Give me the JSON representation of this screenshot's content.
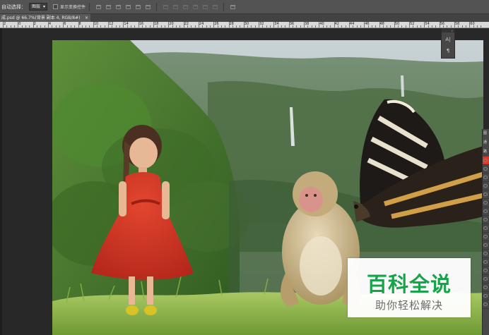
{
  "options_bar": {
    "auto_select_label": "自动选择：",
    "auto_select_value": "图层",
    "show_transform_label": "显示变换控件"
  },
  "document_tab": {
    "title": "成.psd @ 66.7%(背景 副本 4, RGB/8#)",
    "close": "×"
  },
  "ruler": {
    "marks": [
      "2",
      "0",
      "2",
      "4",
      "6",
      "8",
      "10",
      "12",
      "14",
      "16",
      "18",
      "20",
      "22",
      "24",
      "26",
      "28",
      "30",
      "32",
      "34",
      "36",
      "38",
      "40",
      "42",
      "44",
      "46",
      "48",
      "50",
      "52",
      "54",
      "56",
      "58",
      "60"
    ]
  },
  "mini_panel": {
    "icon1": "A|",
    "icon2": "¶"
  },
  "side_panel": {
    "tabs": [
      "图",
      "通",
      "路"
    ]
  },
  "watermark": {
    "line1": "百科全说",
    "line2": "助你轻松解决",
    "color": "#17a34a"
  },
  "colors": {
    "selected_layer": "#d63a2c",
    "workspace": "#282828"
  }
}
